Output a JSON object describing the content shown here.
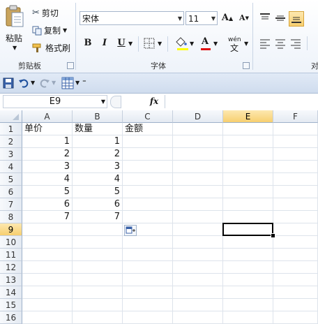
{
  "ribbon": {
    "clipboard": {
      "paste_label": "粘贴",
      "cut_label": "剪切",
      "copy_label": "复制",
      "format_painter_label": "格式刷",
      "group_label": "剪贴板"
    },
    "font": {
      "font_name": "宋体",
      "font_size": "11",
      "grow_label": "A",
      "shrink_label": "A",
      "bold_label": "B",
      "italic_label": "I",
      "underline_label": "U",
      "font_color_label": "A",
      "phonetic_label": "wén",
      "group_label": "字体"
    },
    "alignment": {
      "group_label": "对"
    }
  },
  "formula_bar": {
    "name_box": "E9",
    "fx_label": "fx",
    "formula": ""
  },
  "sheet": {
    "columns": [
      "A",
      "B",
      "C",
      "D",
      "E",
      "F"
    ],
    "rows": [
      "1",
      "2",
      "3",
      "4",
      "5",
      "6",
      "7",
      "8",
      "9",
      "10",
      "11",
      "12",
      "13",
      "14",
      "15",
      "16"
    ],
    "selected_column": "E",
    "selected_row": "9",
    "active_cell": "E9",
    "headers": [
      "单价",
      "数量",
      "金额"
    ],
    "data": [
      [
        "1",
        "1"
      ],
      [
        "2",
        "2"
      ],
      [
        "3",
        "3"
      ],
      [
        "4",
        "4"
      ],
      [
        "5",
        "5"
      ],
      [
        "6",
        "6"
      ],
      [
        "7",
        "7"
      ]
    ]
  },
  "colors": {
    "accent": "#f7cf6f",
    "ribbon_bg": "#eef3fa",
    "grid_line": "#dde3eb"
  }
}
